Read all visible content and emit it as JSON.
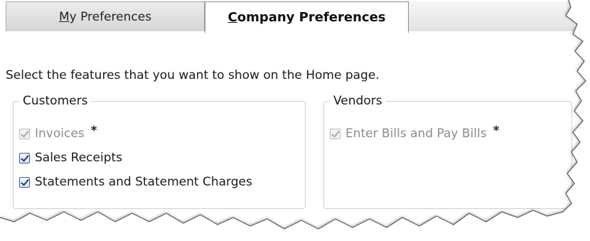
{
  "tabs": {
    "my_preferences": {
      "mnemonic": "M",
      "rest": "y Preferences"
    },
    "company_preferences": {
      "mnemonic": "C",
      "rest": "ompany Preferences"
    }
  },
  "instruction": "Select the features that you want to show on the Home page.",
  "customers": {
    "title": "Customers",
    "items": [
      {
        "label": "Invoices",
        "checked": true,
        "disabled": true,
        "required_mark": "*"
      },
      {
        "label": "Sales Receipts",
        "checked": true,
        "disabled": false
      },
      {
        "label": "Statements and Statement Charges",
        "checked": true,
        "disabled": false
      }
    ]
  },
  "vendors": {
    "title": "Vendors",
    "items": [
      {
        "label": "Enter Bills and Pay Bills",
        "checked": true,
        "disabled": true,
        "required_mark": "*"
      }
    ]
  }
}
